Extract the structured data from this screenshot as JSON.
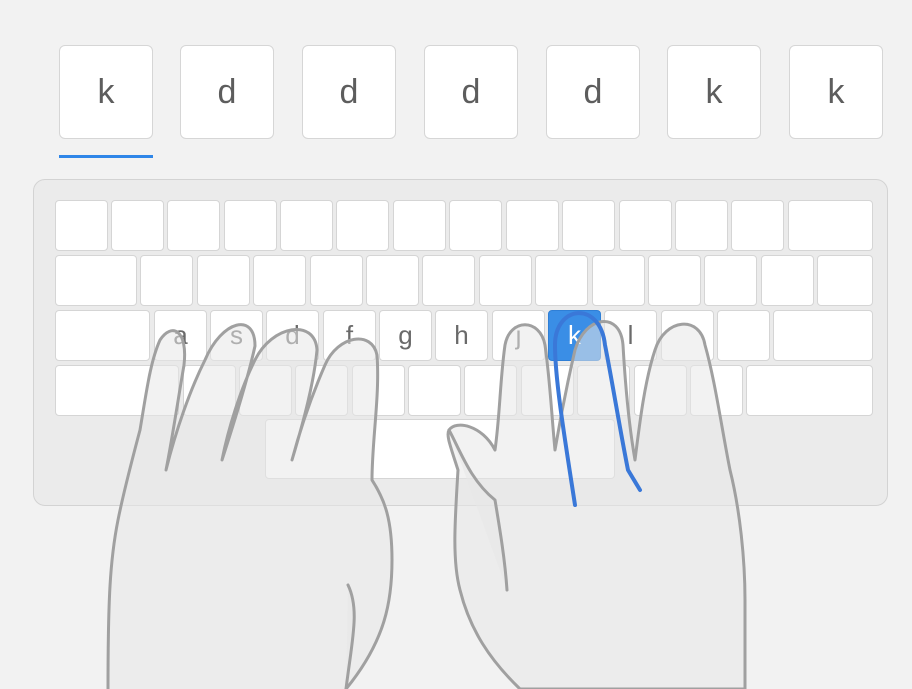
{
  "sequence": [
    "k",
    "d",
    "d",
    "d",
    "d",
    "k",
    "k"
  ],
  "current_index": 0,
  "colors": {
    "accent": "#2f86e8",
    "active_key": "#3a8ee6",
    "hand_outline": "#a0a0a0",
    "active_finger": "#3a78d8"
  },
  "keyboard": {
    "home_row": [
      "a",
      "s",
      "d",
      "f",
      "g",
      "h",
      "j",
      "k",
      "l"
    ],
    "active_key": "k",
    "active_finger": "right-middle-finger"
  }
}
